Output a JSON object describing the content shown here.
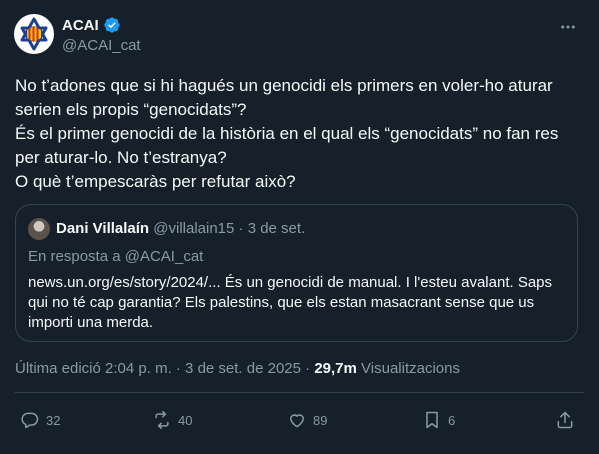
{
  "author": {
    "display_name": "ACAI",
    "handle": "@ACAI_cat",
    "avatar": "star-of-david-senyera-logo",
    "verified_icon": "verified-badge-icon"
  },
  "tweet": {
    "lines": [
      "No t’adones que si hi hagués un genocidi els primers en voler-ho aturar",
      "serien els propis “genocidats”?",
      "És el primer genocidi de la història en el qual els “genocidats” no fan res",
      "per aturar-lo. No t’estranya?",
      "O què t’empescaràs per refutar això?"
    ]
  },
  "quote": {
    "display_name": "Dani Villalaín",
    "meta": "@villalain15 · 3 de set.",
    "reply_prefix": "En resposta a",
    "reply_mention": "@ACAI_cat",
    "lines": [
      "news.un.org/es/story/2024/... És un genocidi de manual. I l'esteu avalant. Saps",
      "qui no té cap garantia? Els palestins, que els estan masacrant sense que us",
      "importi una merda."
    ]
  },
  "meta": {
    "edited": "Última edició 2:04 p. m. · 3 de set. de 2025 ·",
    "views_count": "29,7m",
    "views_label": "Visualitzacions"
  },
  "actions": {
    "replies": "32",
    "retweets": "40",
    "likes": "89",
    "bookmarks": "6"
  },
  "colors": {
    "background": "#15202b",
    "text": "#f7f9f9",
    "muted": "#8b98a5",
    "border": "#38444d",
    "verified": "#1d9bf0"
  }
}
